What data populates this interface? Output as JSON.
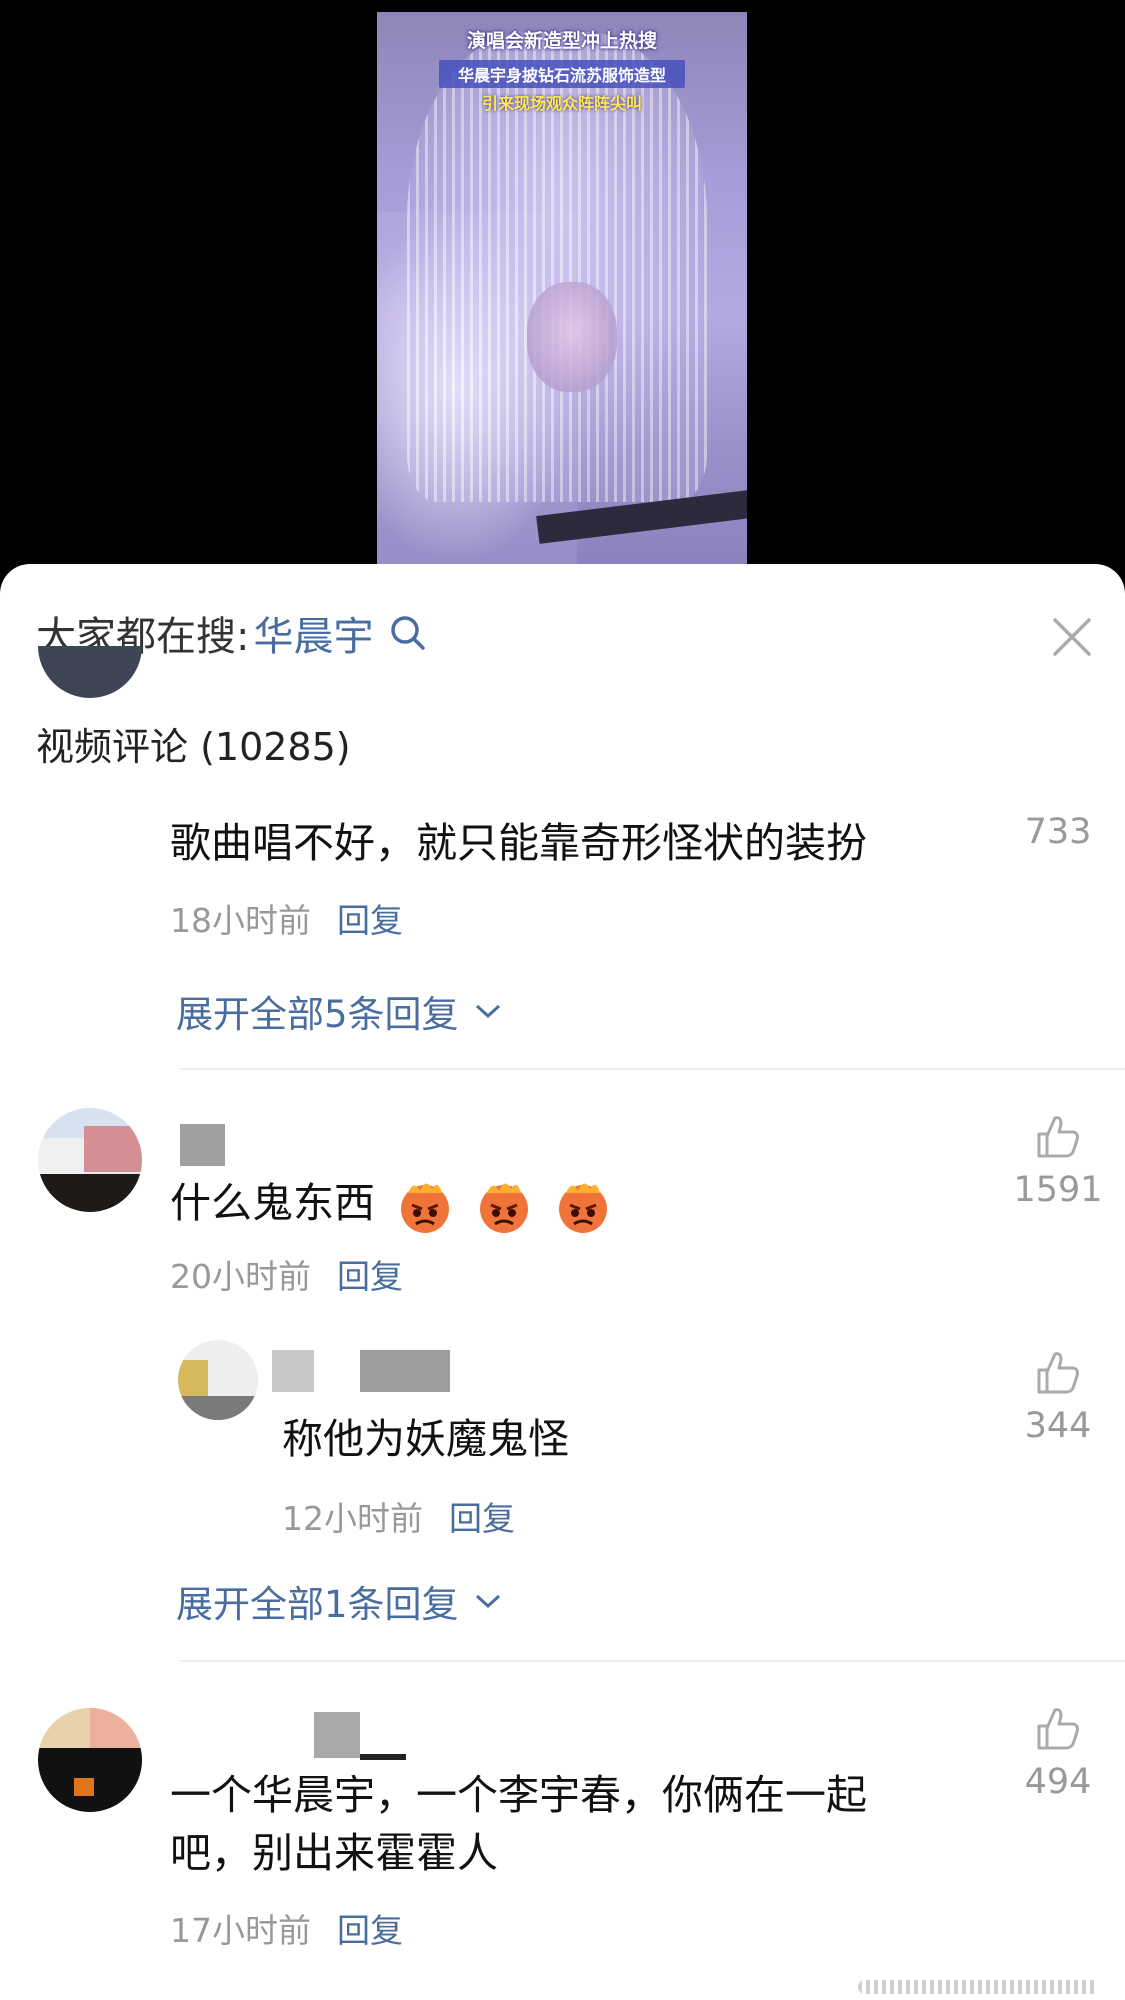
{
  "video": {
    "caption_line1": "演唱会新造型冲上热搜",
    "caption_line2": "华晨宇身披钻石流苏服饰造型",
    "caption_line3": "引来现场观众阵阵尖叫"
  },
  "search": {
    "prefix": "大家都在搜:",
    "term": "华晨宇",
    "icon": "search-icon"
  },
  "close": {
    "icon": "close-icon"
  },
  "section": {
    "title": "视频评论 (10285)"
  },
  "comments": [
    {
      "text": "歌曲唱不好，就只能靠奇形怪状的装扮",
      "time": "18小时前",
      "reply_label": "回复",
      "likes": "733",
      "expand_label": "展开全部5条回复"
    },
    {
      "text": "什么鬼东西",
      "emojis": [
        "angry-fire-emoji",
        "angry-fire-emoji",
        "angry-fire-emoji"
      ],
      "time": "20小时前",
      "reply_label": "回复",
      "likes": "1591",
      "reply": {
        "text": "称他为妖魔鬼怪",
        "time": "12小时前",
        "reply_label": "回复",
        "likes": "344"
      },
      "expand_label": "展开全部1条回复"
    },
    {
      "text_line1": "一个华晨宇，一个李宇春，你俩在一起",
      "text_line2": "吧，别出来霍霍人",
      "time": "17小时前",
      "reply_label": "回复",
      "likes": "494"
    }
  ],
  "colors": {
    "link_blue": "#4a6da0",
    "meta_gray": "#999999",
    "text_dark": "#111111"
  }
}
